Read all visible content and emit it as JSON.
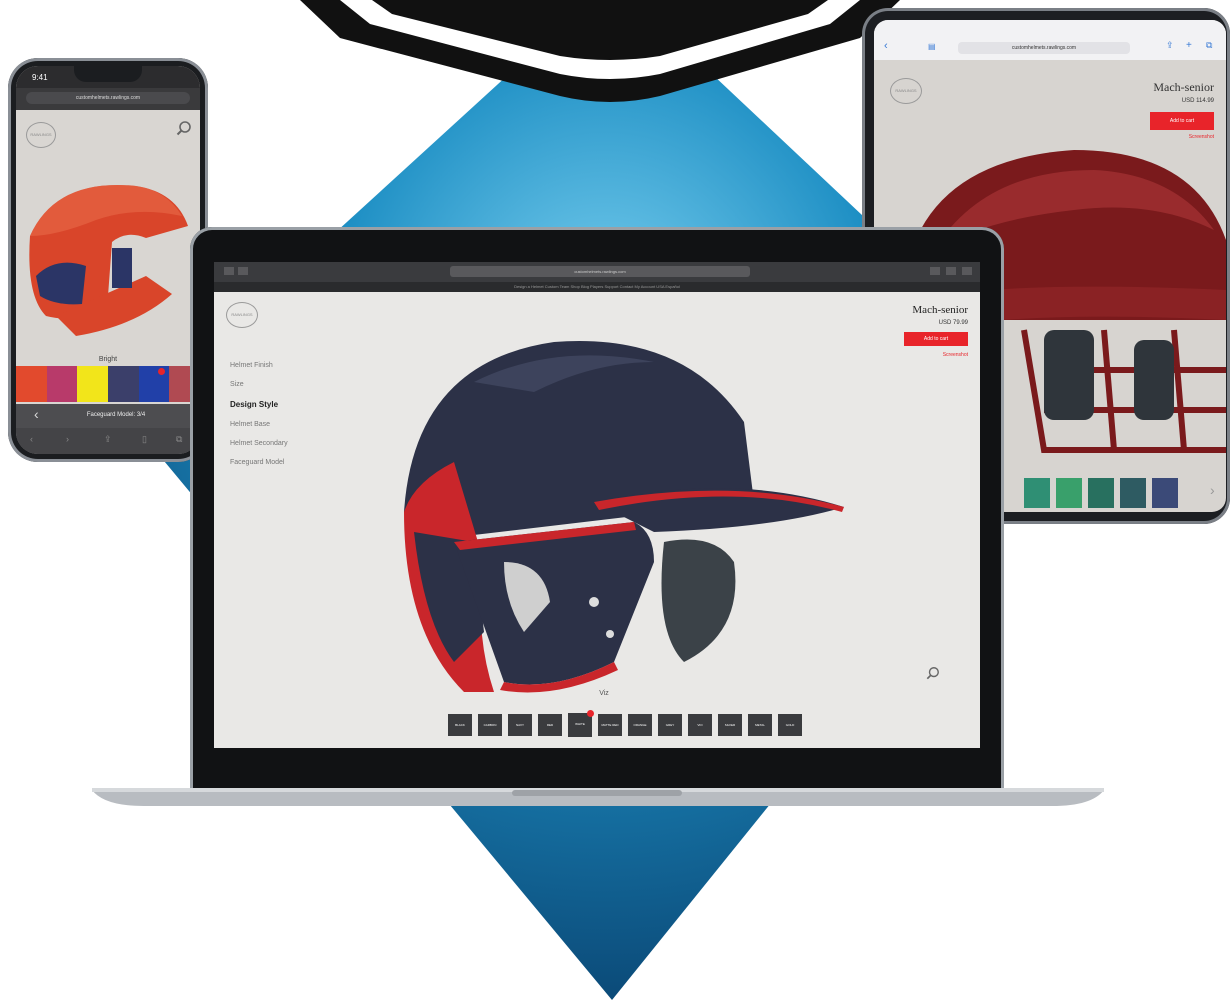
{
  "phone": {
    "status_time": "9:41",
    "url": "customhelmets.rawlings.com",
    "logo_text": "RAWLINGS",
    "color_label": "Bright",
    "bottom_label": "Faceguard Model: 3/4",
    "swatch_colors": [
      "#e24a2d",
      "#b83a6a",
      "#f2e51a",
      "#3b3f6a",
      "#2140a8",
      "#b04a52"
    ],
    "selected_swatch": 4
  },
  "tablet": {
    "url": "customhelmets.rawlings.com",
    "logo_text": "RAWLINGS",
    "product_title": "Mach-senior",
    "price": "USD 114.99",
    "cart_label": "Add to cart",
    "screenshot_label": "Screenshot",
    "swatch_colors": [
      "#2f8f74",
      "#39a06b",
      "#28705f",
      "#2e5b62",
      "#3b4a78"
    ]
  },
  "laptop": {
    "url": "customhelmets.rawlings.com",
    "menu": "Design a Helmet   Custom   Team   Shop   Blog   Players   Support   Contact   My Account   USA   Español",
    "logo_text": "RAWLINGS",
    "nav_items": [
      "Helmet Finish",
      "Size",
      "Design Style",
      "Helmet Base",
      "Helmet Secondary",
      "Faceguard Model"
    ],
    "active_nav": 2,
    "product_title": "Mach-senior",
    "price": "USD 79.99",
    "cart_label": "Add to cart",
    "screenshot_label": "Screenshot",
    "viz_label": "Viz",
    "swatches": [
      "BLACK",
      "CARBON",
      "NAVY",
      "RED",
      "WHITE",
      "MATTE RED",
      "ORANGE",
      "GREY",
      "VIO",
      "SILVER",
      "METAL",
      "GOLD"
    ],
    "selected_swatch": 4
  },
  "colors": {
    "accent_red": "#e8242a",
    "diamond_blue": "#1c8fc4"
  }
}
